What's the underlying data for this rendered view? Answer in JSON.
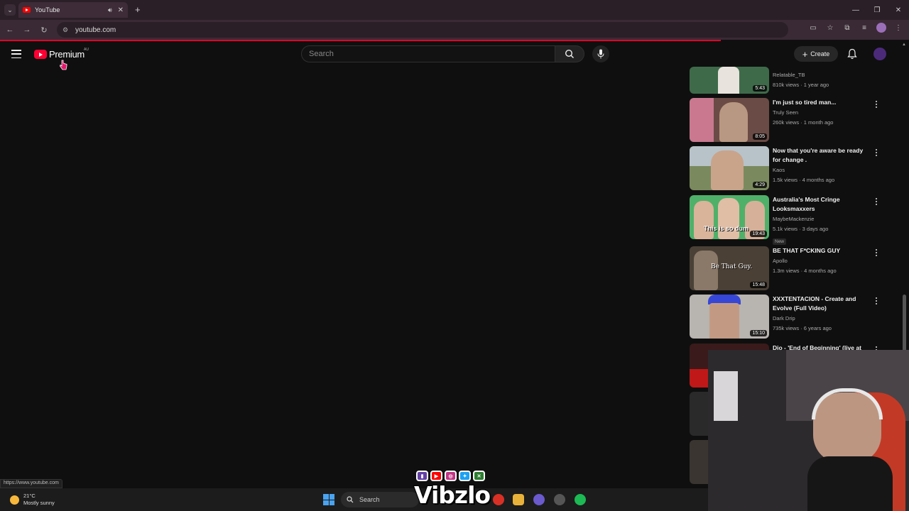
{
  "browser": {
    "tab_title": "YouTube",
    "address": "youtube.com",
    "status_url": "https://www.youtube.com"
  },
  "youtube": {
    "logo_text": "Premium",
    "country_code": "AU",
    "search_placeholder": "Search",
    "create_label": "Create"
  },
  "videos": [
    {
      "title": "",
      "channel": "Relatable_TB",
      "meta": "810k views · 1 year ago",
      "duration": "5:43",
      "thumb_color": "#3f6a4a",
      "badge": ""
    },
    {
      "title": "I'm just so tired man...",
      "channel": "Truly Seen",
      "meta": "260k views · 1 month ago",
      "duration": "8:05",
      "thumb_color": "#6b4b45",
      "badge": ""
    },
    {
      "title": "Now that you're aware be ready for change .",
      "channel": "Kaos",
      "meta": "1.5k views · 4 months ago",
      "duration": "4:29",
      "thumb_color": "#7a8a5e",
      "badge": ""
    },
    {
      "title": "Australia's Most Cringe Looksmaxxers",
      "channel": "MaybeMackenzie",
      "meta": "5.1k views · 3 days ago",
      "duration": "19:43",
      "thumb_color": "#4fb069",
      "badge": "New"
    },
    {
      "title": "BE THAT F*CKING GUY",
      "channel": "Apollo",
      "meta": "1.3m views · 4 months ago",
      "duration": "15:48",
      "thumb_color": "#4a4036",
      "badge": ""
    },
    {
      "title": "XXXTENTACION - Create and Evolve (Full Video)",
      "channel": "Dark Drip",
      "meta": "735k views · 6 years ago",
      "duration": "15:10",
      "thumb_color": "#b8b4b0",
      "badge": ""
    },
    {
      "title": "Djo - 'End of Beginning' (live at",
      "channel": "",
      "meta": "",
      "duration": "",
      "thumb_color": "#3a1a1a",
      "badge": ""
    }
  ],
  "thumb_overlays": {
    "looksmaxx": "This is so dum",
    "guy": "Be That Guy."
  },
  "taskbar": {
    "temperature": "21°C",
    "condition": "Mostly sunny",
    "search_label": "Search"
  },
  "overlay": {
    "streamer_name": "Vibzlo"
  },
  "colors": {
    "accent_red": "#ff0033",
    "background": "#0f0f0f"
  }
}
